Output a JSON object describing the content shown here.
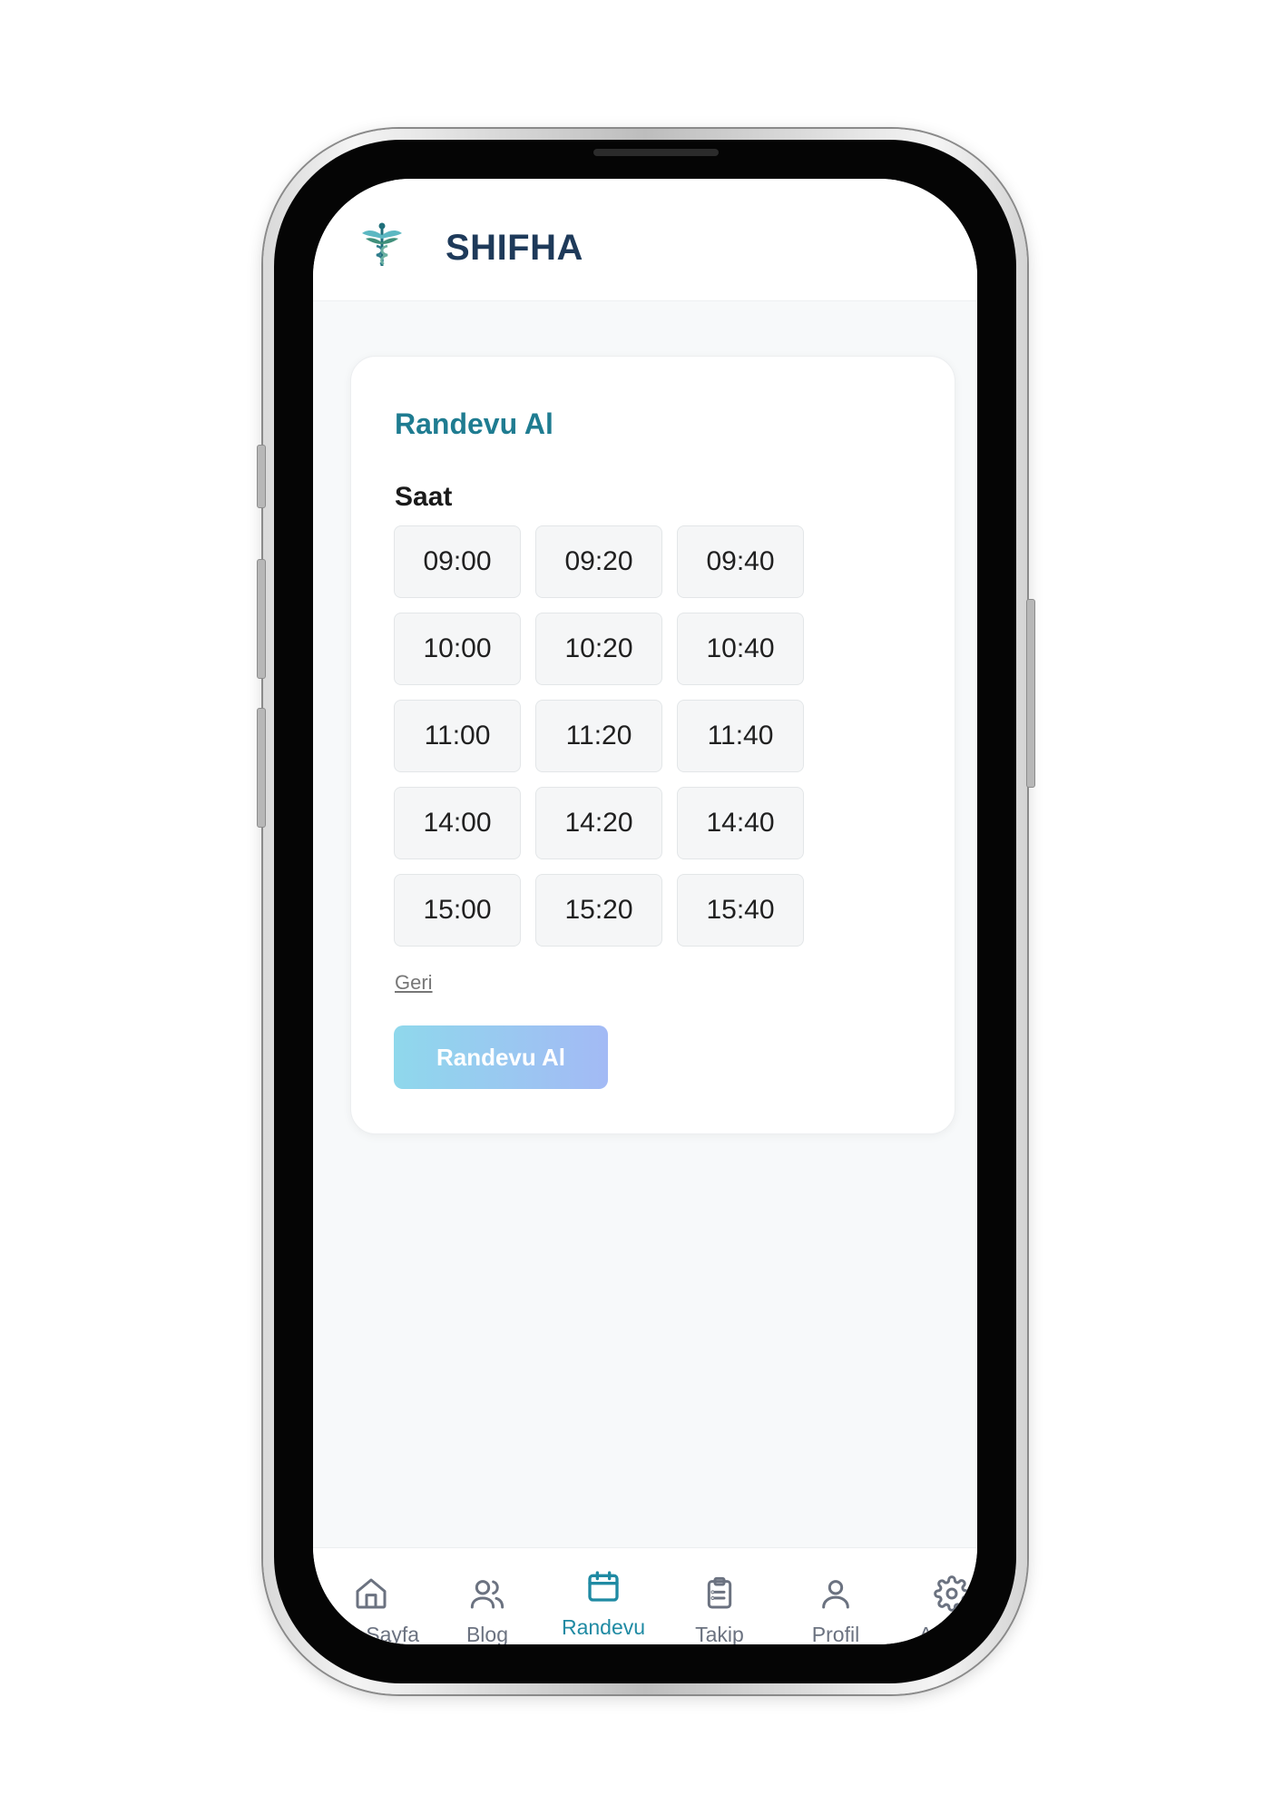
{
  "app": {
    "brand": "SHIFHA",
    "accent_color": "#1f8aa3",
    "logo_icon": "caduceus-logo-icon"
  },
  "card": {
    "title": "Randevu Al",
    "section_label": "Saat",
    "time_slots": [
      "09:00",
      "09:20",
      "09:40",
      "10:00",
      "10:20",
      "10:40",
      "11:00",
      "11:20",
      "11:40",
      "14:00",
      "14:20",
      "14:40",
      "15:00",
      "15:20",
      "15:40"
    ],
    "back_label": "Geri",
    "submit_label": "Randevu Al"
  },
  "nav": {
    "items": [
      {
        "label": "Ana Sayfa",
        "icon": "home-icon",
        "active": false
      },
      {
        "label": "Blog",
        "icon": "users-icon",
        "active": false
      },
      {
        "label": "Randevu",
        "icon": "calendar-icon",
        "active": true
      },
      {
        "label": "Takip",
        "icon": "clipboard-icon",
        "active": false
      },
      {
        "label": "Profil",
        "icon": "user-icon",
        "active": false
      },
      {
        "label": "Ayarlar",
        "icon": "gear-icon",
        "active": false
      }
    ]
  }
}
